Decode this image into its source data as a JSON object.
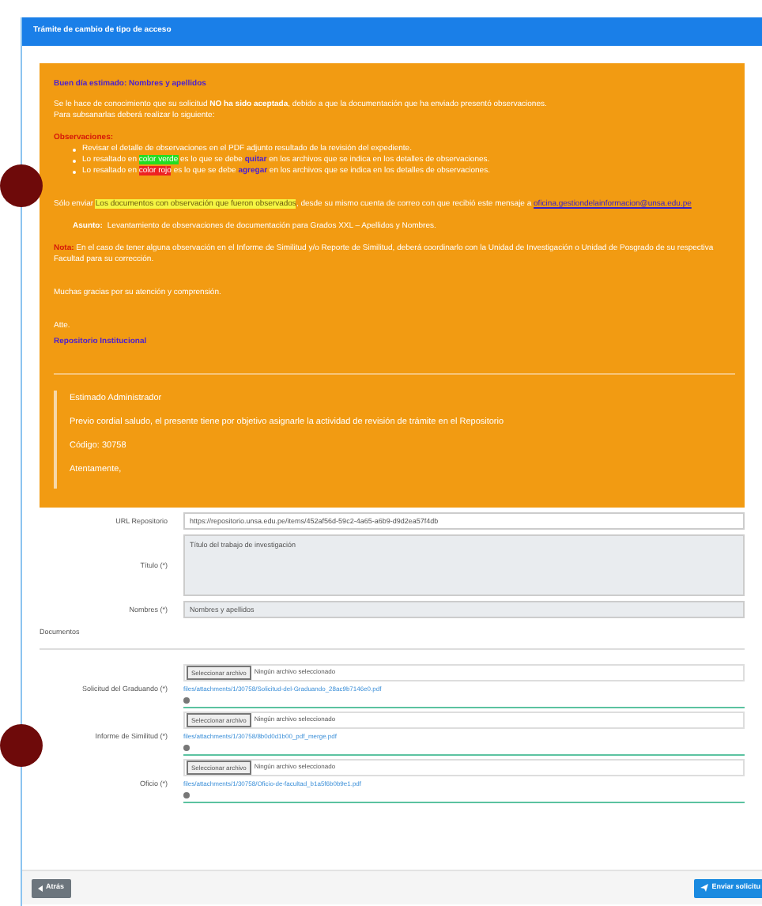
{
  "panel": {
    "title": "Trámite de cambio de tipo de acceso"
  },
  "message": {
    "greeting": "Buen día estimado: Nombres y apellidos",
    "intro": [
      {
        "kind": "plain",
        "text": "Se le hace de conocimiento que su solicitud "
      },
      {
        "kind": "bold",
        "text": "NO ha sido aceptada"
      },
      {
        "kind": "plain",
        "text": ", debido a que la documentación que ha enviado presentó observaciones."
      }
    ],
    "intro_2": "Para subsanarlas deberá realizar lo siguiente:",
    "observations_title": "Observaciones:",
    "observations": [
      [
        {
          "kind": "plain",
          "text": "Revisar el detalle de observaciones en el PDF adjunto resultado de la revisión del expediente."
        }
      ],
      [
        {
          "kind": "plain",
          "text": "Lo resaltado en "
        },
        {
          "kind": "mark",
          "color": "#22dd22",
          "text": "color verde"
        },
        {
          "kind": "plain",
          "text": " es lo que se debe "
        },
        {
          "kind": "accent",
          "text": "quitar"
        },
        {
          "kind": "plain",
          "text": " en los archivos que se indica en los detalles de observaciones."
        }
      ],
      [
        {
          "kind": "plain",
          "text": "Lo resaltado en "
        },
        {
          "kind": "mark",
          "color": "#ee2222",
          "text": "color rojo"
        },
        {
          "kind": "plain",
          "text": " es lo que se debe "
        },
        {
          "kind": "accent",
          "text": "agregar"
        },
        {
          "kind": "plain",
          "text": " en los archivos que se indica en los detalles de observaciones."
        }
      ]
    ],
    "send": [
      {
        "kind": "plain",
        "text": "Sólo enviar "
      },
      {
        "kind": "mark",
        "color": "#f5f542",
        "text": "Los documentos con observación que fueron observados"
      },
      {
        "kind": "plain",
        "text": ", desde su mismo cuenta de correo con que recibió este mensaje a "
      },
      {
        "kind": "link",
        "text": "oficina.gestiondelainformacion@unsa.edu.pe"
      }
    ],
    "subject_label": "Asunto:",
    "subject": "Levantamiento de observaciones de documentación para Grados XXL – Apellidos y Nombres.",
    "note_label": "Nota:",
    "note": "En el caso de tener alguna observación en el Informe de Similitud y/o Reporte de Similitud, deberá coordinarlo con la Unidad de Investigación o Unidad de Posgrado de su respectiva Facultad para su corrección.",
    "thanks": "Muchas gracias por su atención y comprensión.",
    "closing": "Atte.",
    "signature": "Repositorio Institucional",
    "quote": [
      "Estimado Administrador",
      "Previo cordial saludo, el presente tiene por objetivo asignarle la actividad de revisión de trámite en el Repositorio",
      "Código: 30758",
      "Atentamente,"
    ]
  },
  "form": {
    "fields": [
      {
        "kind": "input",
        "label": "URL Repositorio",
        "value": "https://repositorio.unsa.edu.pe/items/452af56d-59c2-4a65-a6b9-d9d2ea57f4db",
        "disabled": false
      },
      {
        "kind": "textarea",
        "label": "Título (*)",
        "value": "Título del trabajo de investigación",
        "disabled": true
      },
      {
        "kind": "input",
        "label": "Nombres (*)",
        "value": "Nombres y apellidos",
        "disabled": true
      }
    ],
    "section": "Documentos",
    "files": [
      {
        "label": "Solicitud del Graduando (*)",
        "button": "Seleccionar archivo",
        "status": "Ningún archivo seleccionado",
        "link": "files/attachments/1/30758/Solicitud-del-Graduando_28ac9b7146e0.pdf"
      },
      {
        "label": "Informe de Similitud (*)",
        "button": "Seleccionar archivo",
        "status": "Ningún archivo seleccionado",
        "link": "files/attachments/1/30758/8b0d0d1b00_pdf_merge.pdf"
      },
      {
        "label": "Oficio (*)",
        "button": "Seleccionar archivo",
        "status": "Ningún archivo seleccionado",
        "link": "files/attachments/1/30758/Oficio-de-facultad_b1a5f6b0b9e1.pdf"
      }
    ]
  },
  "footer": {
    "back": "Atrás",
    "submit": "Enviar solicitu"
  }
}
